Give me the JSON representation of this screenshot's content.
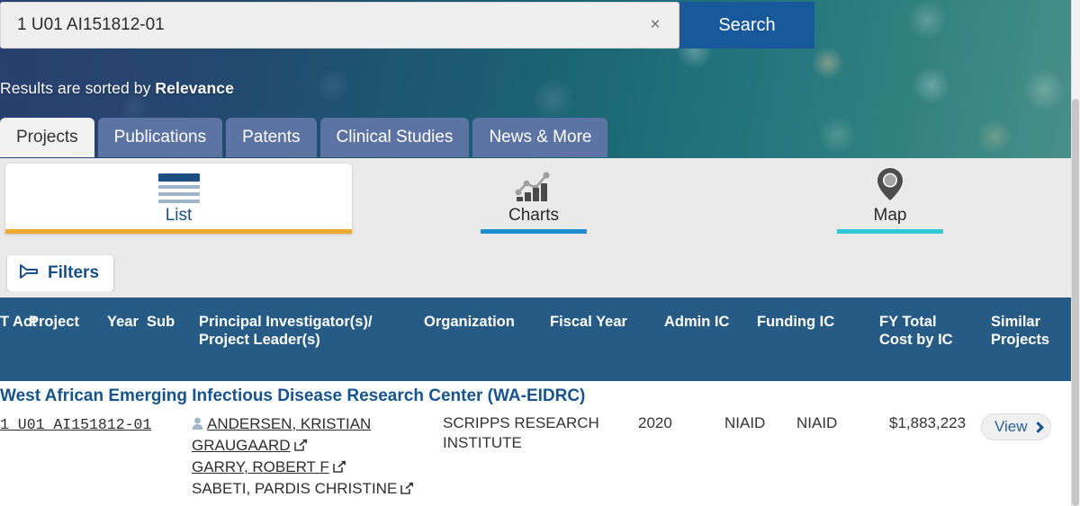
{
  "search": {
    "query": "1 U01 AI151812-01",
    "placeholder": "Search",
    "clear_label": "×",
    "button_label": "Search"
  },
  "banner": {
    "sorted_prefix": "Results are sorted by ",
    "sorted_value": "Relevance"
  },
  "tabs": [
    {
      "label": "Projects",
      "active": true
    },
    {
      "label": "Publications",
      "active": false
    },
    {
      "label": "Patents",
      "active": false
    },
    {
      "label": "Clinical Studies",
      "active": false
    },
    {
      "label": "News & More",
      "active": false
    }
  ],
  "views": [
    {
      "label": "List",
      "icon": "list-icon",
      "active": true,
      "accent": "#f0a92e"
    },
    {
      "label": "Charts",
      "icon": "charts-icon",
      "active": false,
      "accent": "#1f8fcf"
    },
    {
      "label": "Map",
      "icon": "map-pin-icon",
      "active": false,
      "accent": "#2fc6d6"
    }
  ],
  "filters": {
    "label": "Filters",
    "icon": "funnel-icon"
  },
  "table": {
    "headers": [
      "T Act",
      "Project",
      "Year",
      "Sub",
      "Principal Investigator(s)/",
      "Project Leader(s)",
      "Organization",
      "Fiscal Year",
      "Admin IC",
      "Funding IC",
      "FY Total",
      "Cost by IC",
      "Similar",
      "Projects"
    ],
    "rows": [
      {
        "title": "West African Emerging Infectious Disease Research Center (WA-EIDRC)",
        "project_number": "1 U01 AI151812-01",
        "investigators": [
          {
            "name": "ANDERSEN, KRISTIAN",
            "name2": "GRAUGAARD",
            "external": true,
            "underlined": true,
            "has_person_icon": true
          },
          {
            "name": "GARRY, ROBERT F",
            "external": true,
            "underlined": true,
            "has_person_icon": false
          },
          {
            "name": "SABETI, PARDIS CHRISTINE",
            "external": true,
            "underlined": false,
            "has_person_icon": false
          }
        ],
        "organization_line1": "SCRIPPS RESEARCH",
        "organization_line2": "INSTITUTE",
        "fiscal_year": "2020",
        "admin_ic": "NIAID",
        "funding_ic": "NIAID",
        "fy_total_cost": "$1,883,223",
        "view_label": "View"
      }
    ]
  },
  "colors": {
    "header_blue": "#265b85",
    "search_button": "#18599c",
    "tab_inactive": "#5c74a3",
    "link_blue": "#16548f",
    "list_accent": "#f0a92e",
    "charts_accent": "#1f8fcf",
    "map_accent": "#2fc6d6"
  }
}
